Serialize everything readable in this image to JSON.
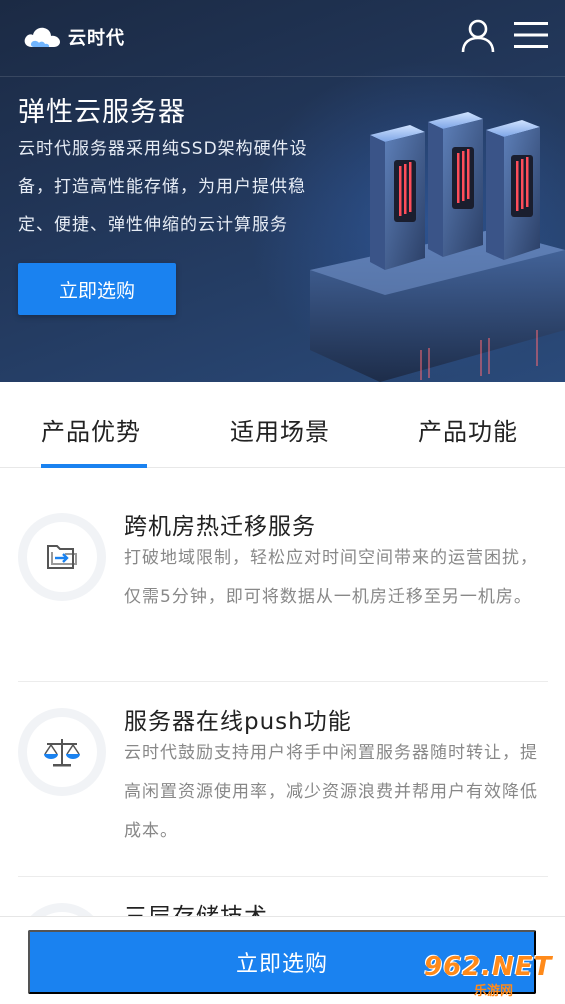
{
  "header": {
    "logo_text": "云时代",
    "icons": [
      "cloud-logo-icon",
      "user-icon",
      "menu-icon"
    ]
  },
  "hero": {
    "title": "弹性云服务器",
    "description": "云时代服务器采用纯SSD架构硬件设备，打造高性能存储，为用户提供稳定、便捷、弹性伸缩的云计算服务",
    "button_label": "立即选购"
  },
  "tabs": [
    {
      "label": "产品优势",
      "active": true
    },
    {
      "label": "适用场景",
      "active": false
    },
    {
      "label": "产品功能",
      "active": false
    }
  ],
  "features": [
    {
      "icon": "folder-transfer-icon",
      "title": "跨机房热迁移服务",
      "description": "打破地域限制，轻松应对时间空间带来的运营困扰，仅需5分钟，即可将数据从一机房迁移至另一机房。"
    },
    {
      "icon": "balance-scale-icon",
      "title": "服务器在线push功能",
      "description": "云时代鼓励支持用户将手中闲置服务器随时转让，提高闲置资源使用率，减少资源浪费并帮用户有效降低成本。"
    },
    {
      "icon": "storage-icon",
      "title": "三层存储技术",
      "description": ""
    }
  ],
  "bottom": {
    "button_label": "立即选购"
  },
  "watermark": {
    "main": "962.NET",
    "sub": "乐游网"
  },
  "colors": {
    "accent": "#1a82f0",
    "hero_bg": "#22375a",
    "watermark": "#ff8a1a"
  }
}
